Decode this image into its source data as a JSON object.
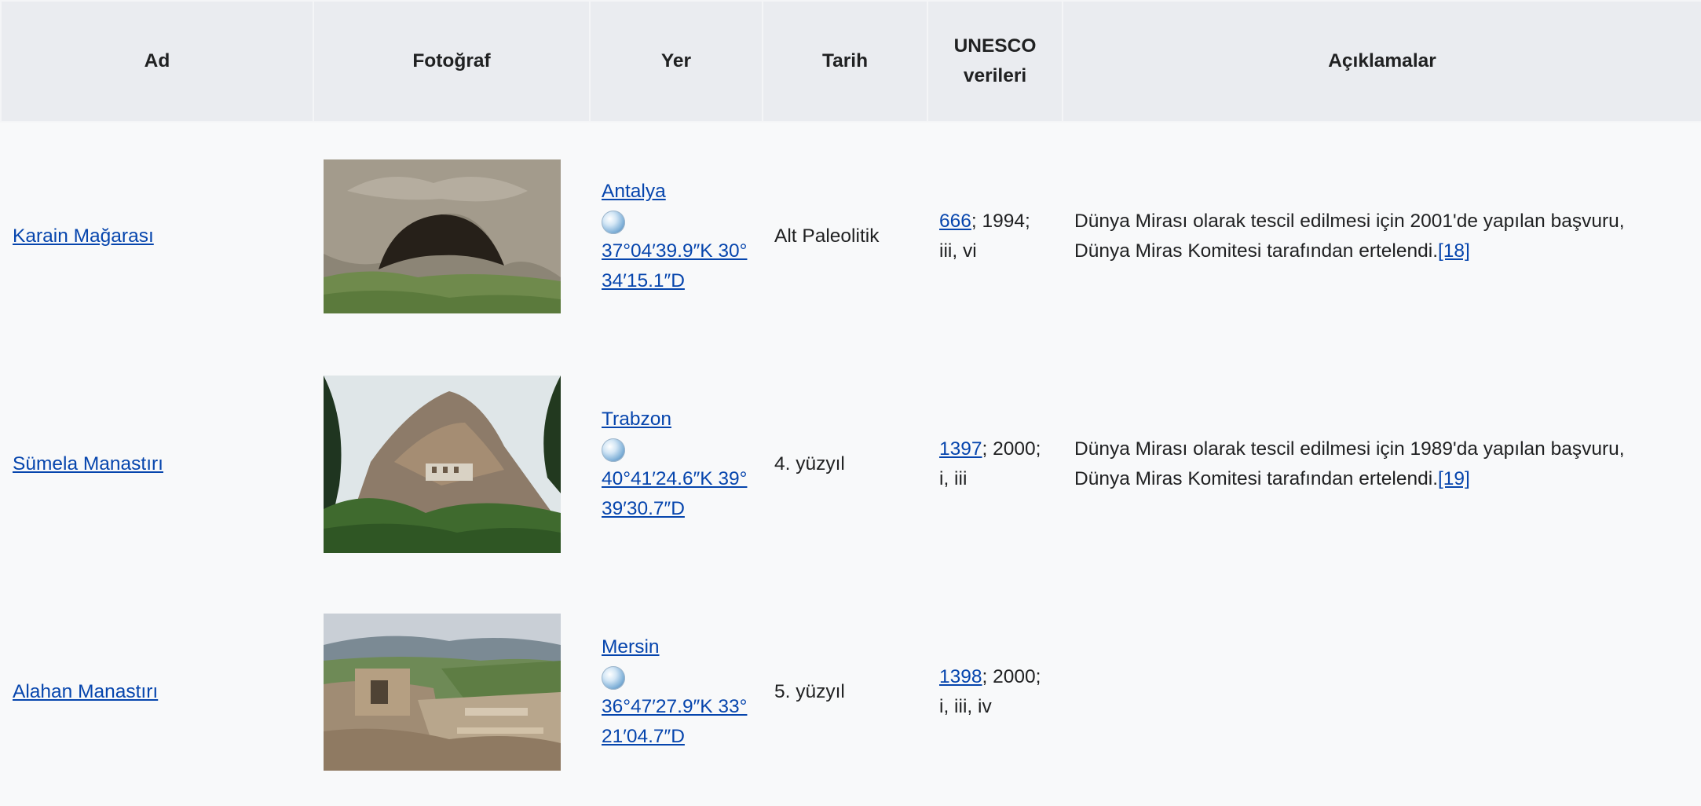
{
  "headers": {
    "name": "Ad",
    "photo": "Fotoğraf",
    "location": "Yer",
    "date": "Tarih",
    "unesco_line1": "UNESCO",
    "unesco_line2": "verileri",
    "notes": "Açıklamalar"
  },
  "rows": [
    {
      "name": "Karain Mağarası",
      "photo_icon": "cave-photo",
      "city": "Antalya",
      "coord_line1": "37°04′39.9″K 30°",
      "coord_line2": "34′15.1″D",
      "date": "Alt Paleolitik",
      "unesco_id": "666",
      "unesco_rest1": "; 1994;",
      "unesco_rest2": "iii, vi",
      "notes_line1": "Dünya Mirası olarak tescil edilmesi için 2001'de yapılan başvuru,",
      "notes_line2": "Dünya Miras Komitesi tarafından ertelendi.",
      "ref": "[18]"
    },
    {
      "name": "Sümela Manastırı",
      "photo_icon": "monastery-cliff-photo",
      "city": "Trabzon",
      "coord_line1": "40°41′24.6″K 39°",
      "coord_line2": "39′30.7″D",
      "date": "4. yüzyıl",
      "unesco_id": "1397",
      "unesco_rest1": "; 2000;",
      "unesco_rest2": "i, iii",
      "notes_line1": "Dünya Mirası olarak tescil edilmesi için 1989'da yapılan başvuru,",
      "notes_line2": "Dünya Miras Komitesi tarafından ertelendi.",
      "ref": "[19]"
    },
    {
      "name": "Alahan Manastırı",
      "photo_icon": "ruins-photo",
      "city": "Mersin",
      "coord_line1": "36°47′27.9″K 33°",
      "coord_line2": "21′04.7″D",
      "date": "5. yüzyıl",
      "unesco_id": "1398",
      "unesco_rest1": "; 2000;",
      "unesco_rest2": "i, iii, iv",
      "notes_line1": "",
      "notes_line2": "",
      "ref": ""
    }
  ],
  "icons": {
    "globe": "globe-icon"
  },
  "colors": {
    "link": "#0645ad",
    "header_bg": "#eaecf0",
    "cell_bg": "#f8f9fa",
    "text": "#202122"
  }
}
